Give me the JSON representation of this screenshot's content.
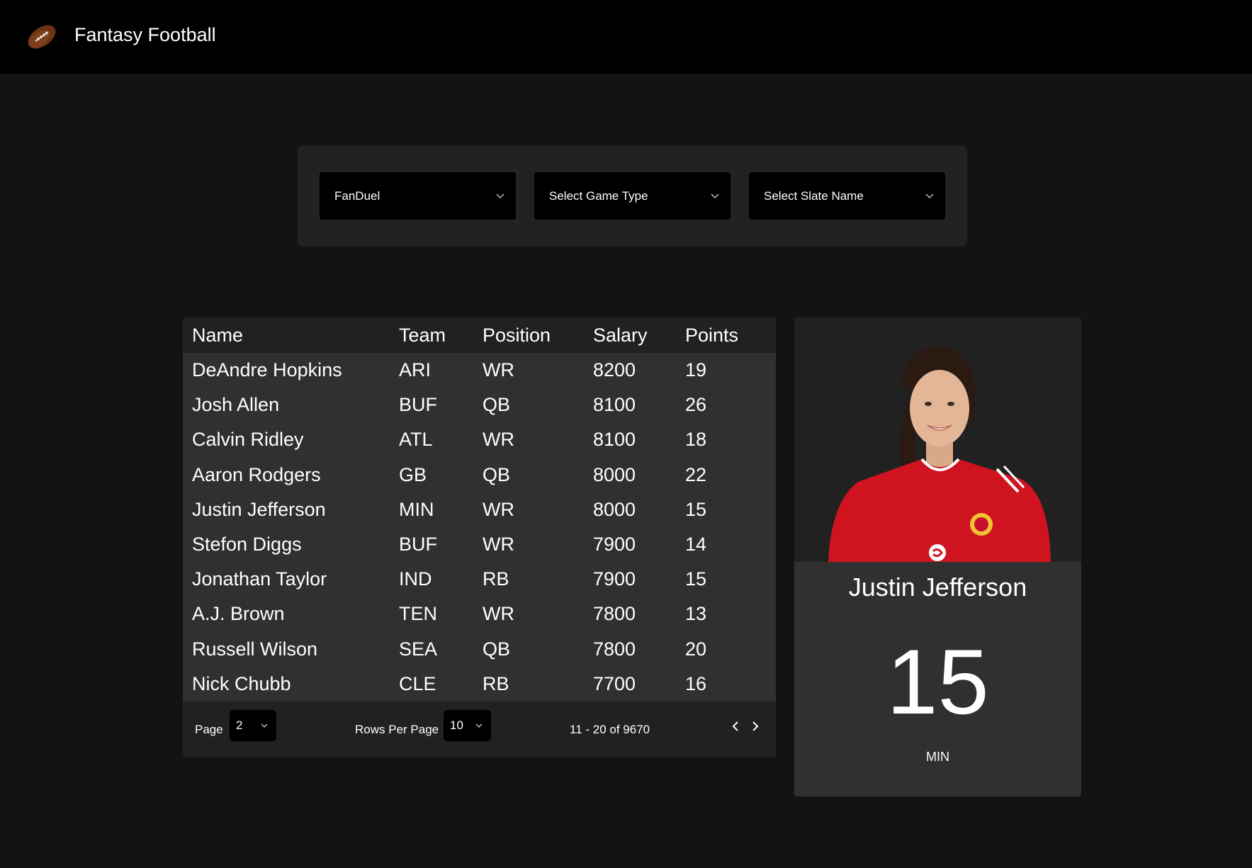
{
  "header": {
    "title": "Fantasy Football",
    "logo_icon": "football-icon"
  },
  "filters": {
    "site": "FanDuel",
    "game_type": "Select Game Type",
    "slate_name": "Select Slate Name"
  },
  "table": {
    "columns": [
      "Name",
      "Team",
      "Position",
      "Salary",
      "Points"
    ],
    "rows": [
      [
        "DeAndre Hopkins",
        "ARI",
        "WR",
        "8200",
        "19"
      ],
      [
        "Josh Allen",
        "BUF",
        "QB",
        "8100",
        "26"
      ],
      [
        "Calvin Ridley",
        "ATL",
        "WR",
        "8100",
        "18"
      ],
      [
        "Aaron Rodgers",
        "GB",
        "QB",
        "8000",
        "22"
      ],
      [
        "Justin Jefferson",
        "MIN",
        "WR",
        "8000",
        "15"
      ],
      [
        "Stefon Diggs",
        "BUF",
        "WR",
        "7900",
        "14"
      ],
      [
        "Jonathan Taylor",
        "IND",
        "RB",
        "7900",
        "15"
      ],
      [
        "A.J. Brown",
        "TEN",
        "WR",
        "7800",
        "13"
      ],
      [
        "Russell Wilson",
        "SEA",
        "QB",
        "7800",
        "20"
      ],
      [
        "Nick Chubb",
        "CLE",
        "RB",
        "7700",
        "16"
      ]
    ]
  },
  "pagination": {
    "page_label": "Page",
    "page_value": "2",
    "rows_label": "Rows Per Page",
    "rows_value": "10",
    "range": "11 - 20 of 9670"
  },
  "player": {
    "name": "Justin Jefferson",
    "points": "15",
    "team": "MIN",
    "photo_icon": "player-photo"
  },
  "colors": {
    "background": "#131313",
    "header": "#000000",
    "panel": "#222222",
    "row": "#303030",
    "jersey": "#d0141f"
  }
}
